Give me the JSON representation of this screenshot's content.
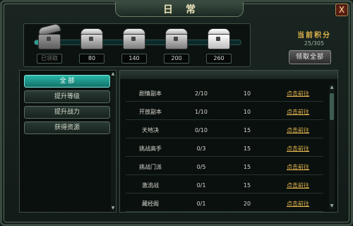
{
  "window": {
    "title": "日常",
    "close_label": "X"
  },
  "progress": {
    "fraction": 0.06,
    "chests": [
      {
        "label": "已领取",
        "state": "claimed"
      },
      {
        "label": "80",
        "state": "locked"
      },
      {
        "label": "140",
        "state": "locked"
      },
      {
        "label": "200",
        "state": "locked"
      },
      {
        "label": "260",
        "state": "locked"
      }
    ]
  },
  "score": {
    "title": "当前积分",
    "value": "25/305",
    "claim_all": "领取全部"
  },
  "categories": [
    {
      "label": "全 部",
      "active": true
    },
    {
      "label": "提升等级",
      "active": false
    },
    {
      "label": "提升战力",
      "active": false
    },
    {
      "label": "获得资源",
      "active": false
    }
  ],
  "tasks": [
    {
      "name": "剧情副本",
      "progress": "2/10",
      "points": "10",
      "action": "点击前往"
    },
    {
      "name": "开放副本",
      "progress": "1/10",
      "points": "10",
      "action": "点击前往"
    },
    {
      "name": "天地决",
      "progress": "0/10",
      "points": "15",
      "action": "点击前往"
    },
    {
      "name": "挑战高手",
      "progress": "0/3",
      "points": "15",
      "action": "点击前往"
    },
    {
      "name": "挑战门派",
      "progress": "0/5",
      "points": "15",
      "action": "点击前往"
    },
    {
      "name": "激流战",
      "progress": "0/1",
      "points": "15",
      "action": "点击前往"
    },
    {
      "name": "藏经阁",
      "progress": "0/1",
      "points": "20",
      "action": "点击前往"
    }
  ],
  "icons": {
    "close": "close-icon",
    "chest": "treasure-chest-icon",
    "scroll_up": "scroll-up-arrow-icon",
    "scroll_down": "scroll-down-arrow-icon"
  }
}
